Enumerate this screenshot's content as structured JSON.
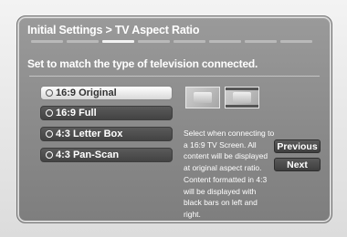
{
  "header": {
    "title": "Initial Settings > TV Aspect Ratio",
    "subtitle": "Set to match the type of television connected."
  },
  "wizard": {
    "step_count": 8,
    "current_step": 3
  },
  "options": [
    {
      "label": "16:9 Original",
      "selected": true
    },
    {
      "label": "16:9 Full",
      "selected": false
    },
    {
      "label": "4:3 Letter Box",
      "selected": false
    },
    {
      "label": "4:3 Pan-Scan",
      "selected": false
    }
  ],
  "description": "Select when connecting to a 16:9 TV Screen. All content will be displayed at original aspect ratio. Content formatted in 4:3 will be displayed with black bars on left and right.",
  "buttons": {
    "previous": "Previous",
    "next": "Next"
  },
  "preview_icons": [
    "tv-preview-icon",
    "tv-preview-icon"
  ]
}
